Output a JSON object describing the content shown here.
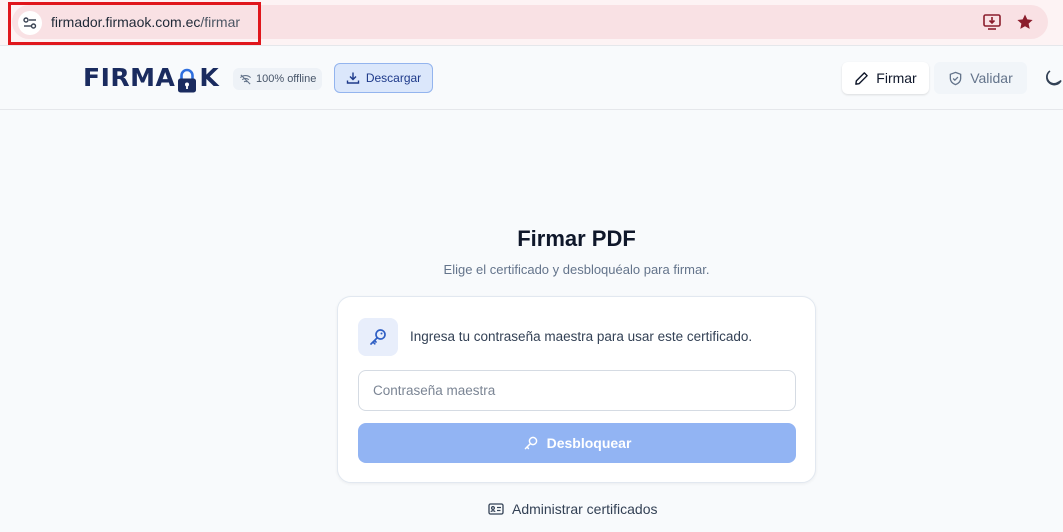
{
  "browser": {
    "url_domain": "firmador.firmaok.com.ec",
    "url_path": "/firmar",
    "icons": [
      "site-info-icon",
      "install-app-icon",
      "bookmark-star-icon"
    ]
  },
  "header": {
    "logo_text_left": "FIRMA",
    "logo_text_right": "K",
    "offline_badge": "100% offline",
    "download_label": "Descargar",
    "nav": {
      "firmar_label": "Firmar",
      "validar_label": "Validar"
    },
    "active_tab": "Firmar"
  },
  "main": {
    "title": "Firmar PDF",
    "subtitle": "Elige el certificado y desbloquéalo para firmar.",
    "card": {
      "message": "Ingresa tu contraseña maestra para usar este certificado.",
      "password_placeholder": "Contraseña maestra",
      "password_value": "",
      "unlock_label": "Desbloquear"
    },
    "manage_label": "Administrar certificados"
  },
  "colors": {
    "accent": "#3b6fd4",
    "logo": "#1a2b5f",
    "unlock_button": "#92b4f3",
    "highlight": "#e0161c"
  }
}
